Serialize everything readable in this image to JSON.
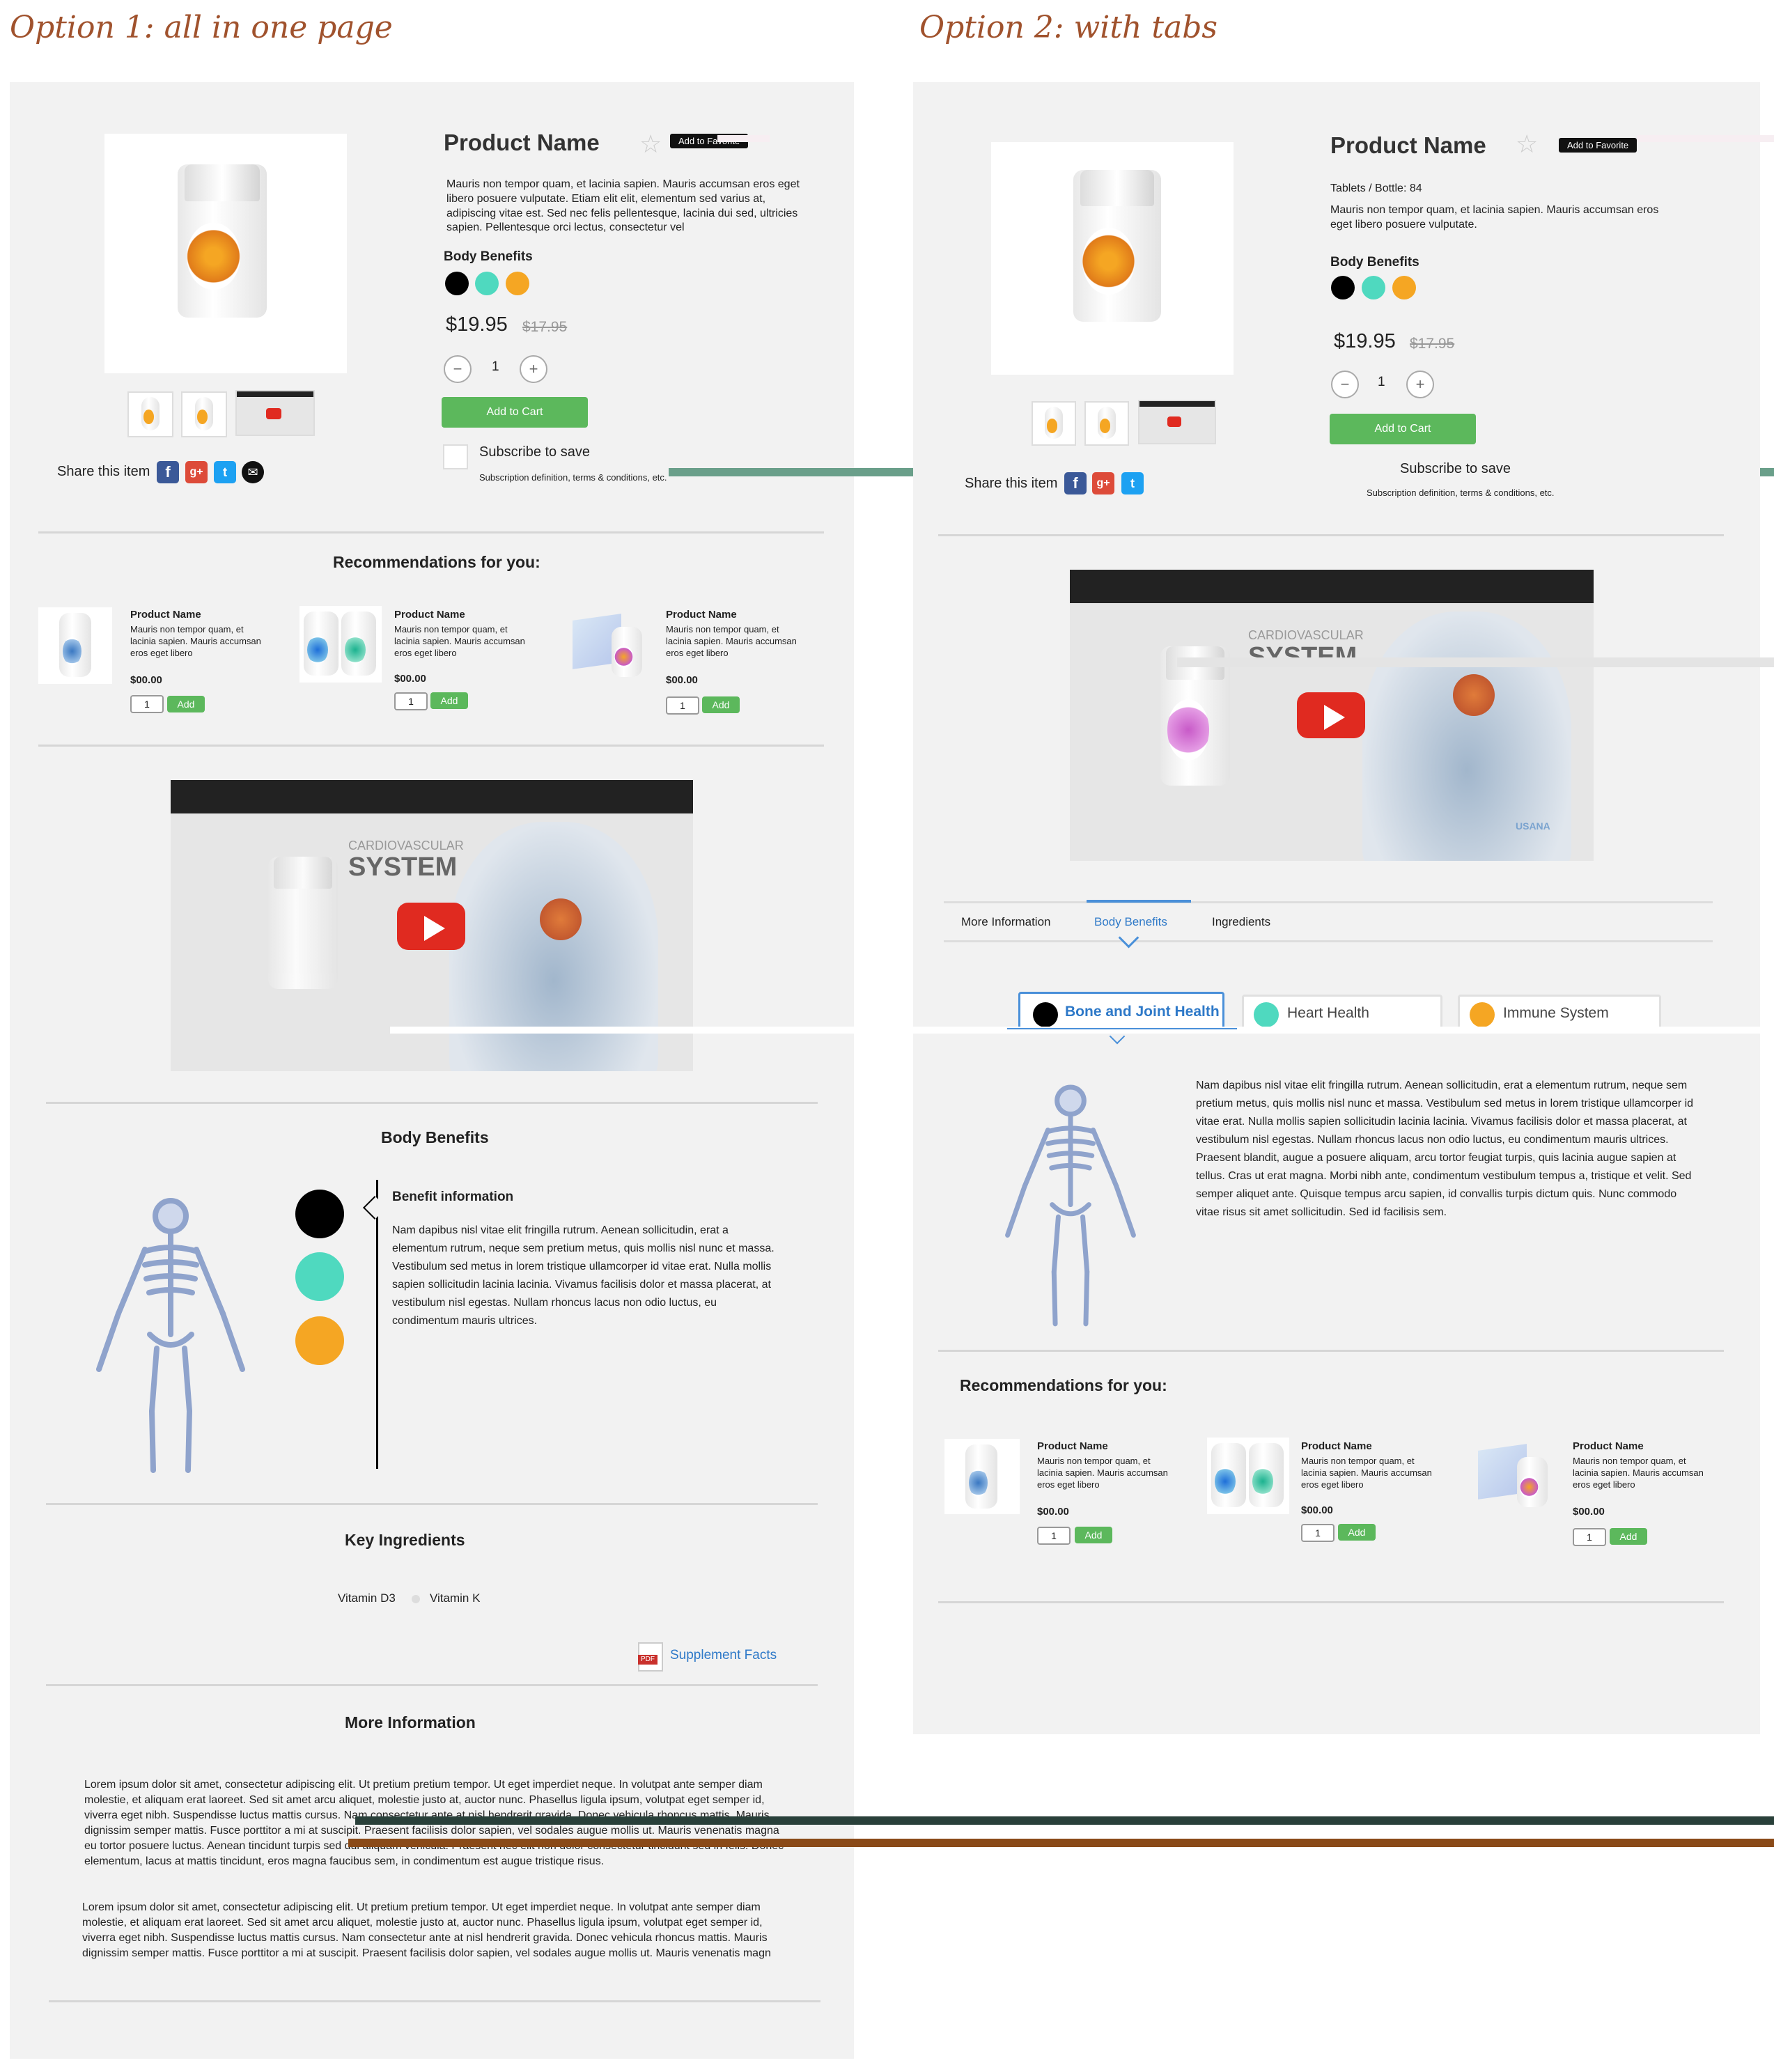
{
  "options": {
    "option1_title": "Option 1: all in one page",
    "option2_title": "Option 2: with tabs"
  },
  "product": {
    "name": "Product Name",
    "favorite_label": "Add to Favorite",
    "description": "Mauris non tempor quam, et lacinia sapien. Mauris accumsan eros eget libero posuere vulputate. Etiam elit elit, elementum sed varius at, adipiscing vitae est. Sed nec felis pellentesque, lacinia dui sed, ultricies sapien. Pellentesque orci lectus, consectetur vel",
    "short_description": "Mauris non tempor quam, et lacinia sapien. Mauris accumsan eros eget libero posuere vulputate.",
    "tablets": "Tablets / Bottle: 84",
    "body_benefits_label": "Body Benefits",
    "price": "$19.95",
    "old_price": "$17.95",
    "qty": "1",
    "minus": "−",
    "plus": "+",
    "add_to_cart": "Add to Cart",
    "subscribe": "Subscribe to save",
    "subscribe_note": "Subscription definition, terms & conditions, etc.",
    "share": "Share this item"
  },
  "benefit_colors": [
    "#000000",
    "#4fd9bf",
    "#f5a623"
  ],
  "recommendations": {
    "title": "Recommendations for you:",
    "items": [
      {
        "name": "Product Name",
        "desc": "Mauris non tempor quam, et lacinia sapien. Mauris accumsan eros eget libero",
        "price": "$00.00",
        "qty": "1",
        "add": "Add"
      },
      {
        "name": "Product Name",
        "desc": "Mauris non tempor quam, et lacinia sapien. Mauris accumsan eros eget libero",
        "price": "$00.00",
        "qty": "1",
        "add": "Add"
      },
      {
        "name": "Product Name",
        "desc": "Mauris non tempor quam, et lacinia sapien. Mauris accumsan eros eget libero",
        "price": "$00.00",
        "qty": "1",
        "add": "Add"
      }
    ]
  },
  "video": {
    "caption_small": "CARDIOVASCULAR",
    "caption_big": "SYSTEM",
    "brand": "USANA"
  },
  "body_benefits": {
    "title": "Body Benefits",
    "info_title": "Benefit information",
    "info_text": "Nam dapibus nisl vitae elit fringilla rutrum. Aenean sollicitudin, erat a elementum rutrum, neque sem pretium metus, quis mollis nisl nunc et massa. Vestibulum sed metus in lorem tristique ullamcorper id vitae erat. Nulla mollis sapien sollicitudin lacinia lacinia. Vivamus facilisis dolor et massa placerat, at vestibulum nisl egestas. Nullam rhoncus lacus non odio luctus, eu condimentum mauris ultrices."
  },
  "ingredients": {
    "title": "Key Ingredients",
    "items": [
      "Vitamin D3",
      "Vitamin K"
    ],
    "pdf_badge": "PDF",
    "supplement_facts": "Supplement Facts"
  },
  "more_info": {
    "title": "More Information",
    "para1": "Lorem ipsum dolor sit amet, consectetur adipiscing elit. Ut pretium pretium tempor. Ut eget imperdiet neque. In volutpat ante semper diam molestie, et aliquam erat laoreet. Sed sit amet arcu aliquet, molestie justo at, auctor nunc. Phasellus ligula ipsum, volutpat eget semper id, viverra eget nibh. Suspendisse luctus mattis cursus. Nam consectetur ante at nisl hendrerit gravida. Donec vehicula rhoncus mattis. Mauris dignissim semper mattis. Fusce porttitor a mi at suscipit. Praesent facilisis dolor sapien, vel sodales augue mollis ut. Mauris venenatis magna eu tortor posuere luctus. Aenean tincidunt turpis sed dui aliquam vehicula. Praesent nec elit non dolor consectetur tincidunt sed in felis. Donec elementum, lacus at mattis tincidunt, eros magna faucibus sem, in condimentum est augue tristique risus.",
    "para2": "Lorem ipsum dolor sit amet, consectetur adipiscing elit. Ut pretium pretium tempor. Ut eget imperdiet neque. In volutpat ante semper diam molestie, et aliquam erat laoreet. Sed sit amet arcu aliquet, molestie justo at, auctor nunc. Phasellus ligula ipsum, volutpat eget semper id, viverra eget nibh. Suspendisse luctus mattis cursus. Nam consectetur ante at nisl hendrerit gravida. Donec vehicula rhoncus mattis. Mauris dignissim semper mattis. Fusce porttitor a mi at suscipit. Praesent facilisis dolor sapien, vel sodales augue mollis ut. Mauris venenatis magn"
  },
  "tabs": {
    "items": [
      "More Information",
      "Body Benefits",
      "Ingredients"
    ],
    "active": "Body Benefits",
    "benefit_tabs": [
      "Bone and Joint Health",
      "Heart Health",
      "Immune System"
    ],
    "tab_text": "Nam dapibus nisl vitae elit fringilla rutrum. Aenean sollicitudin, erat a elementum rutrum, neque sem pretium metus, quis mollis nisl nunc et massa. Vestibulum sed metus in lorem tristique ullamcorper id vitae erat. Nulla mollis sapien sollicitudin lacinia lacinia. Vivamus facilisis dolor et massa placerat, at vestibulum nisl egestas. Nullam rhoncus lacus non odio luctus, eu condimentum mauris ultrices. Praesent blandit, augue a posuere aliquam, arcu tortor feugiat turpis, quis lacinia augue sapien at tellus. Cras ut erat magna. Morbi nibh ante, condimentum vestibulum tempus a, tristique et velit. Sed semper aliquet ante. Quisque tempus arcu sapien, id convallis turpis dictum quis. Nunc commodo vitae risus sit amet sollicitudin. Sed id facilisis sem."
  }
}
